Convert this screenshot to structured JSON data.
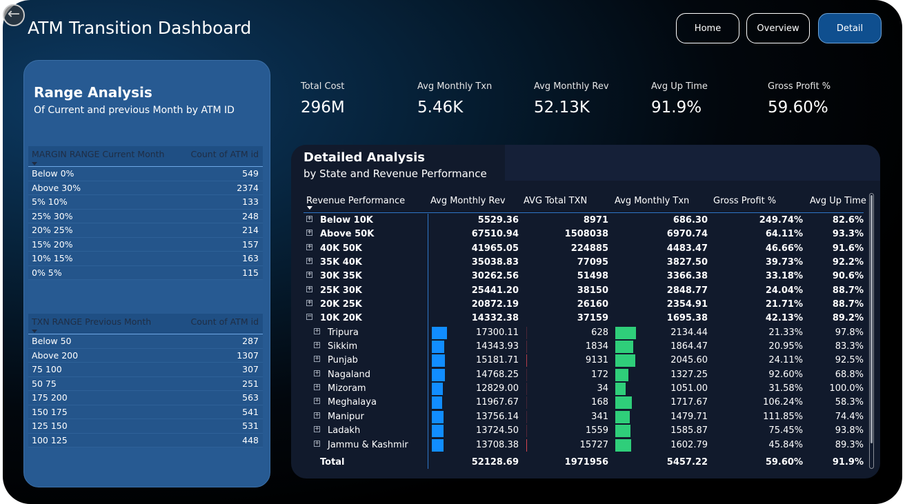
{
  "header": {
    "title": "ATM Transition Dashboard",
    "nav": [
      "Home",
      "Overview",
      "Detail"
    ]
  },
  "range_panel": {
    "title": "Range Analysis",
    "subtitle": "Of Current and previous Month by ATM ID",
    "margin_table": {
      "col1": "MARGIN RANGE Current Month",
      "col2": "Count of ATM id",
      "rows": [
        [
          "Below 0%",
          "549"
        ],
        [
          "Above 30%",
          "2374"
        ],
        [
          "5% 10%",
          "133"
        ],
        [
          "25% 30%",
          "248"
        ],
        [
          "20% 25%",
          "214"
        ],
        [
          "15% 20%",
          "157"
        ],
        [
          "10% 15%",
          "163"
        ],
        [
          "0% 5%",
          "115"
        ]
      ]
    },
    "txn_table": {
      "col1": "TXN RANGE Previous Month",
      "col2": "Count of ATM id",
      "rows": [
        [
          "Below 50",
          "287"
        ],
        [
          "Above 200",
          "1307"
        ],
        [
          "75 100",
          "307"
        ],
        [
          "50 75",
          "251"
        ],
        [
          "175 200",
          "563"
        ],
        [
          "150 175",
          "541"
        ],
        [
          "125 150",
          "531"
        ],
        [
          "100 125",
          "448"
        ]
      ]
    }
  },
  "kpis": [
    {
      "label": "Total Cost",
      "value": "296M"
    },
    {
      "label": "Avg Monthly Txn",
      "value": "5.46K"
    },
    {
      "label": "Avg Monthly Rev",
      "value": "52.13K"
    },
    {
      "label": "Avg Up Time",
      "value": "91.9%"
    },
    {
      "label": "Gross Profit %",
      "value": "59.60%"
    }
  ],
  "detail": {
    "title": "Detailed Analysis",
    "subtitle": "by State and Revenue Performance",
    "columns": [
      "Revenue Performance",
      "Avg Monthly Rev",
      "AVG Total TXN",
      "Avg Monthly Txn",
      "Gross Profit %",
      "Avg Up Time"
    ],
    "groups": [
      {
        "name": "Below 10K",
        "rev": "5529.36",
        "total_txn": "8971",
        "monthly_txn": "686.30",
        "gp": "249.74%",
        "uptime": "82.6%",
        "expanded": false
      },
      {
        "name": "Above 50K",
        "rev": "67510.94",
        "total_txn": "1508038",
        "monthly_txn": "6970.74",
        "gp": "64.11%",
        "uptime": "93.3%",
        "expanded": false
      },
      {
        "name": "40K 50K",
        "rev": "41965.05",
        "total_txn": "224885",
        "monthly_txn": "4483.47",
        "gp": "46.66%",
        "uptime": "91.6%",
        "expanded": false
      },
      {
        "name": "35K 40K",
        "rev": "35038.83",
        "total_txn": "77095",
        "monthly_txn": "3827.50",
        "gp": "39.73%",
        "uptime": "92.2%",
        "expanded": false
      },
      {
        "name": "30K 35K",
        "rev": "30262.56",
        "total_txn": "51498",
        "monthly_txn": "3366.38",
        "gp": "33.18%",
        "uptime": "90.6%",
        "expanded": false
      },
      {
        "name": "25K 30K",
        "rev": "25441.20",
        "total_txn": "38150",
        "monthly_txn": "2848.77",
        "gp": "24.04%",
        "uptime": "88.7%",
        "expanded": false
      },
      {
        "name": "20K 25K",
        "rev": "20872.19",
        "total_txn": "26160",
        "monthly_txn": "2354.91",
        "gp": "21.71%",
        "uptime": "88.7%",
        "expanded": false
      },
      {
        "name": "10K 20K",
        "rev": "14332.38",
        "total_txn": "37159",
        "monthly_txn": "1695.38",
        "gp": "42.13%",
        "uptime": "89.2%",
        "expanded": true
      }
    ],
    "states": [
      {
        "name": "Tripura",
        "rev": "17300.11",
        "total_txn": "628",
        "monthly_txn": "2134.44",
        "gp": "21.33%",
        "uptime": "97.8%"
      },
      {
        "name": "Sikkim",
        "rev": "14343.93",
        "total_txn": "1834",
        "monthly_txn": "1864.47",
        "gp": "20.95%",
        "uptime": "83.3%"
      },
      {
        "name": "Punjab",
        "rev": "15181.71",
        "total_txn": "9131",
        "monthly_txn": "2045.60",
        "gp": "24.11%",
        "uptime": "92.5%"
      },
      {
        "name": "Nagaland",
        "rev": "14768.25",
        "total_txn": "172",
        "monthly_txn": "1327.25",
        "gp": "92.60%",
        "uptime": "68.8%"
      },
      {
        "name": "Mizoram",
        "rev": "12829.00",
        "total_txn": "34",
        "monthly_txn": "1051.00",
        "gp": "31.58%",
        "uptime": "100.0%"
      },
      {
        "name": "Meghalaya",
        "rev": "11967.67",
        "total_txn": "168",
        "monthly_txn": "1717.67",
        "gp": "106.24%",
        "uptime": "58.3%"
      },
      {
        "name": "Manipur",
        "rev": "13756.14",
        "total_txn": "341",
        "monthly_txn": "1479.71",
        "gp": "111.85%",
        "uptime": "74.4%"
      },
      {
        "name": "Ladakh",
        "rev": "13724.50",
        "total_txn": "1559",
        "monthly_txn": "1585.87",
        "gp": "75.45%",
        "uptime": "93.8%"
      },
      {
        "name": "Jammu & Kashmir",
        "rev": "13708.38",
        "total_txn": "15727",
        "monthly_txn": "1602.79",
        "gp": "45.84%",
        "uptime": "89.3%"
      }
    ],
    "total": {
      "label": "Total",
      "rev": "52128.69",
      "total_txn": "1971956",
      "monthly_txn": "5457.22",
      "gp": "59.60%",
      "uptime": "91.9%"
    }
  },
  "colors": {
    "rev_bar": "#118dff",
    "txn_bar": "#2fce7a",
    "total_txn_bar": "#d64550"
  }
}
